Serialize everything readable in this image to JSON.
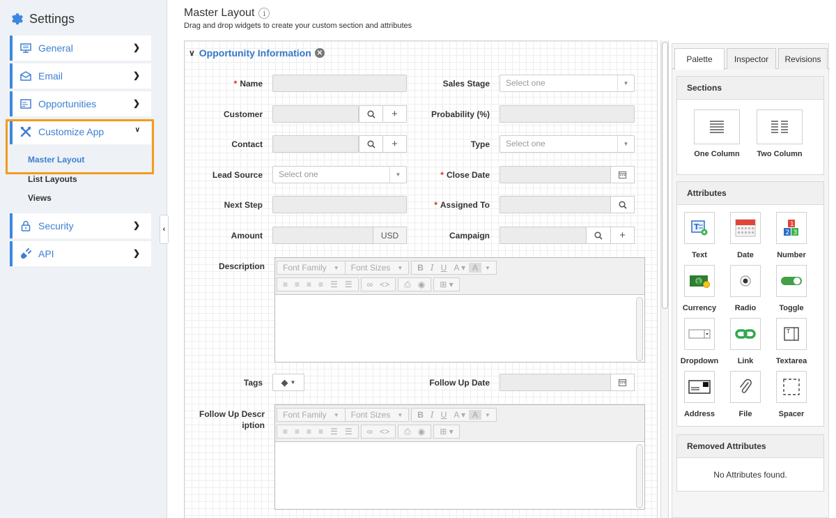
{
  "sidebar": {
    "title": "Settings",
    "items": [
      {
        "label": "General",
        "icon": "monitor-icon"
      },
      {
        "label": "Email",
        "icon": "envelope-icon"
      },
      {
        "label": "Opportunities",
        "icon": "list-icon"
      },
      {
        "label": "Customize App",
        "icon": "tools-icon"
      },
      {
        "label": "Security",
        "icon": "lock-icon"
      },
      {
        "label": "API",
        "icon": "plug-icon"
      }
    ],
    "subitems": [
      "Master Layout",
      "List Layouts",
      "Views"
    ]
  },
  "header": {
    "title": "Master Layout",
    "subtitle": "Drag and drop widgets to create your custom section and attributes"
  },
  "form": {
    "section_title": "Opportunity Information",
    "name": "Name",
    "sales_stage": "Sales Stage",
    "customer": "Customer",
    "probability": "Probability (%)",
    "contact": "Contact",
    "type": "Type",
    "lead_source": "Lead Source",
    "close_date": "Close Date",
    "next_step": "Next Step",
    "assigned_to": "Assigned To",
    "amount": "Amount",
    "currency": "USD",
    "campaign": "Campaign",
    "description": "Description",
    "tags": "Tags",
    "follow_up_date": "Follow Up Date",
    "follow_up_desc_1": "Follow Up Descr",
    "follow_up_desc_2": "iption",
    "select_placeholder": "Select one",
    "editor_font_family": "Font Family",
    "editor_font_sizes": "Font Sizes"
  },
  "panel": {
    "tabs": [
      "Palette",
      "Inspector",
      "Revisions"
    ],
    "sections_title": "Sections",
    "sections": [
      "One Column",
      "Two Column"
    ],
    "attributes_title": "Attributes",
    "attributes": [
      "Text",
      "Date",
      "Number",
      "Currency",
      "Radio",
      "Toggle",
      "Dropdown",
      "Link",
      "Textarea",
      "Address",
      "File",
      "Spacer"
    ],
    "removed_title": "Removed Attributes",
    "removed_empty": "No Attributes found."
  },
  "colors": {
    "accent": "#3d87e0",
    "highlight": "#f39b1d",
    "required": "#d0331a"
  }
}
